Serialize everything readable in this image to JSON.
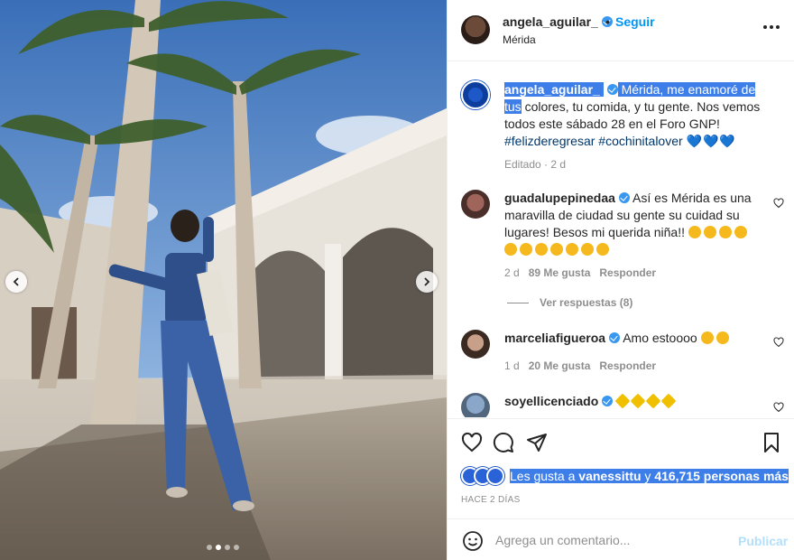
{
  "post": {
    "author": "angela_aguilar_",
    "follow_label": "Seguir",
    "bullet": "•",
    "location": "Mérida"
  },
  "caption": {
    "username": "angela_aguilar_",
    "text_selected": "Mérida, me enamoré de tus",
    "text_rest": "colores, tu comida, y tu gente. Nos vemos todos este sábado 28 en el Foro GNP!",
    "hashtag1": "#felizderegresar",
    "hashtag2": "#cochinitalover",
    "hearts": "💙💙💙",
    "edited": "Editado · 2 d"
  },
  "comments": [
    {
      "username": "guadalupepinedaa",
      "text": "Así es Mérida es una maravilla de ciudad su gente su cuidad su lugares! Besos mi querida niña!!",
      "age": "2 d",
      "likes": "89 Me gusta",
      "reply": "Responder"
    },
    {
      "username": "marceliafigueroa",
      "text": "Amo estoooo",
      "age": "1 d",
      "likes": "20 Me gusta",
      "reply": "Responder"
    },
    {
      "username": "soyellicenciado",
      "text": ""
    }
  ],
  "view_replies": "Ver respuestas (8)",
  "likes_summary": {
    "prefix": "Les gusta a",
    "user": "vanessittu",
    "middle": "y",
    "count": "416,715 personas más"
  },
  "time_ago": "HACE 2 DÍAS",
  "add_comment": {
    "placeholder": "Agrega un comentario...",
    "post_label": "Publicar"
  },
  "carousel": {
    "count": 4,
    "active_index": 1
  },
  "colors": {
    "accent": "#0095f6",
    "selection": "#3e7ee8",
    "hashtag": "#00376b",
    "muted": "#8e8e8e"
  }
}
